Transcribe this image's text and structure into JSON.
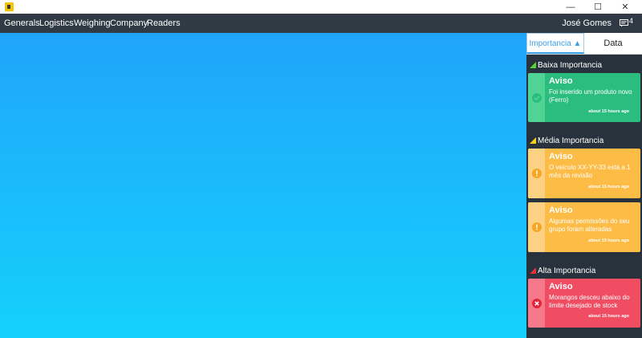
{
  "titlebar": {
    "min": "—",
    "max": "☐",
    "close": "✕"
  },
  "menu": {
    "items": [
      "Generals",
      "Logistics",
      "Weighing",
      "Company",
      "Readers"
    ],
    "user": "José Gomes",
    "notif_count": "4"
  },
  "panel": {
    "tabs": {
      "importance": "Importancia ▲",
      "date": "Data"
    },
    "sections": [
      {
        "title": "Baixa Importancia",
        "color": "#5bd03a",
        "cards": [
          {
            "title": "Aviso",
            "message": "Foi inserido um produto novo (Ferro)",
            "time": "about 15 hours ago",
            "icon": "check-circle-icon"
          }
        ]
      },
      {
        "title": "Média Importancia",
        "color": "#f6d21a",
        "cards": [
          {
            "title": "Aviso",
            "message": "O veículo XX-YY-33 está a 1 mês da revisão",
            "time": "about 15 hours ago",
            "icon": "warning-circle-icon"
          },
          {
            "title": "Aviso",
            "message": "Algumas permissões do seu grupo foram alteradas",
            "time": "about 15 hours ago",
            "icon": "warning-circle-icon"
          }
        ]
      },
      {
        "title": "Alta Importancia",
        "color": "#e8303a",
        "cards": [
          {
            "title": "Aviso",
            "message": "Morangos desceu abaixo do limite desejado de stock",
            "time": "about 15 hours ago",
            "icon": "error-circle-icon"
          }
        ]
      }
    ]
  },
  "colors": {
    "green": "#2bbd7e",
    "green_strip": "#4fd496",
    "amber": "#fdbc45",
    "amber_strip": "#fdd184",
    "red": "#f04d63",
    "red_strip": "#f57989"
  }
}
